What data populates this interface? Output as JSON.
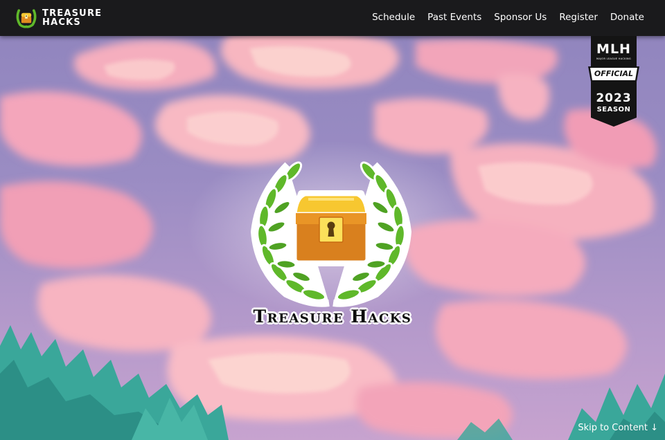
{
  "brand": {
    "line1": "TREASURE",
    "line2": "HACKS",
    "logo_icon": "treasure-chest-laurel-icon"
  },
  "nav": {
    "links": [
      {
        "label": "Schedule"
      },
      {
        "label": "Past Events"
      },
      {
        "label": "Sponsor Us"
      },
      {
        "label": "Register"
      },
      {
        "label": "Donate"
      }
    ]
  },
  "mlh_badge": {
    "word": "MLH",
    "tiny": "MAJOR LEAGUE HACKING",
    "official": "OFFICIAL",
    "year": "2023",
    "season": "SEASON"
  },
  "hero": {
    "title": "Treasure Hacks",
    "logo_icon": "treasure-chest-laurel-icon"
  },
  "skip_link": "Skip to Content ↓",
  "colors": {
    "nav_bg": "#1a1a1c",
    "sky": "#8f84bd",
    "cloud_pink": "#f3a9be",
    "grass": "#3aa79a",
    "laurel": "#5fb82a",
    "chest_gold": "#f2b622",
    "chest_orange": "#d9801e"
  }
}
